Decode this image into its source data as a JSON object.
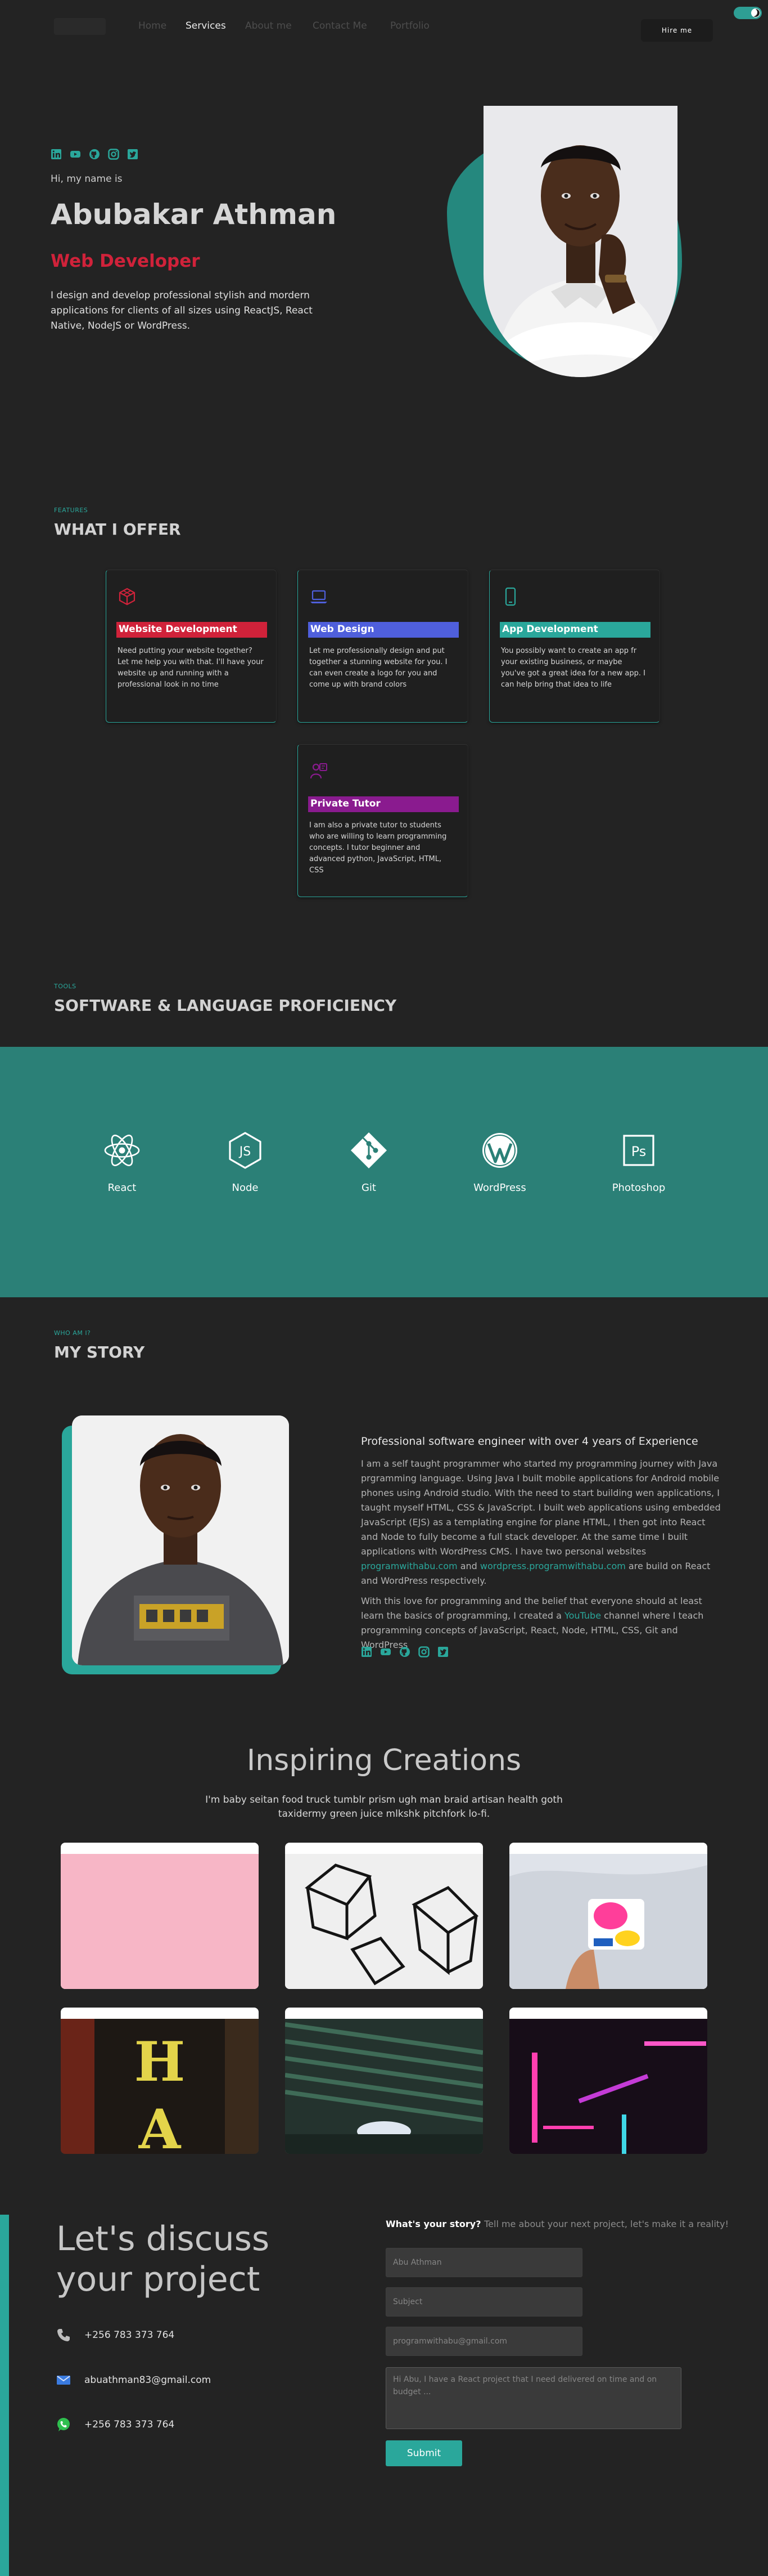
{
  "nav": {
    "links": [
      "Home",
      "Services",
      "About me",
      "Contact Me",
      "Portfolio"
    ],
    "hire_label": "Hire me"
  },
  "hero": {
    "greeting": "Hi, my name is",
    "name": "Abubakar Athman",
    "role": "Web Developer",
    "description": "I design and develop professional stylish and mordern applications for clients of all sizes using ReactJS, React Native, NodeJS or WordPress.",
    "socials": [
      "linkedin-icon",
      "youtube-icon",
      "github-icon",
      "instagram-icon",
      "twitter-icon"
    ]
  },
  "services": {
    "tag": "FEATURES",
    "title": "WHAT I OFFER",
    "cards": [
      {
        "title": "Website Development",
        "text": "Need putting your website together? Let me help you with that. I'll have your website up and running with a professional look in no time",
        "color": "#d0223a",
        "icon": "cube-icon"
      },
      {
        "title": "Web Design",
        "text": "Let me professionally design and put together a stunning website for you. I can even create a logo for you and come up with brand colors",
        "color": "#4f5fdc",
        "icon": "laptop-icon"
      },
      {
        "title": "App Development",
        "text": "You possibly want to create an app fr your existing business, or maybe you've got a great idea for a new app. I can help bring that idea to life",
        "color": "#2aa79b",
        "icon": "phone-icon"
      },
      {
        "title": "Private Tutor",
        "text": "I am also a private tutor to students who are willing to learn programming concepts. I tutor beginner and advanced python, JavaScript, HTML, CSS",
        "color": "#8a1b8f",
        "icon": "tutor-icon"
      }
    ]
  },
  "skills": {
    "tag": "TOOLS",
    "title": "SOFTWARE & LANGUAGE PROFICIENCY",
    "items": [
      "React",
      "Node",
      "Git",
      "WordPress",
      "Photoshop"
    ]
  },
  "story": {
    "tag": "WHO AM I?",
    "title": "MY STORY",
    "heading": "Professional software engineer with over 4 years of Experience",
    "p1": "I am a self taught programmer who started my programming journey with Java prgramming language. Using Java I built mobile applications for Android mobile phones using Android studio. With the need to start building wen applications, I taught myself HTML, CSS & JavaScript. I built web applications using embedded JavaScript (EJS) as a templating engine for plane HTML, I then got into React and Node to fully become a full stack developer. At the same time I built applications with WordPress CMS. I have two personal websites",
    "link1": "programwithabu.com",
    "and": "and",
    "link2": "wordpress.programwithabu.com",
    "p1_end": "are build on React and WordPress respectively.",
    "p2_start": "With this love for programming and the belief that everyone should at least learn the basics of programming, I created a",
    "youtube": "YouTube",
    "p2_end": "channel where I teach programming concepts of JavaScript, React, Node, HTML, CSS, Git and WordPress"
  },
  "portfolio": {
    "title": "Inspiring Creations",
    "subtitle": "I'm baby seitan food truck tumblr prism ugh man braid artisan health goth taxidermy green juice mlkshk pitchfork lo-fi."
  },
  "contact": {
    "heading_line1": "Let's discuss",
    "heading_line2": "your project",
    "phone": "+256 783 373 764",
    "email": "abuathman83@gmail.com",
    "whatsapp": "+256 783 373 764",
    "form_intro_bold": "What's your story?",
    "form_intro_rest": "Tell me about your next project, let's make it a reality!",
    "name_placeholder": "Abu Athman",
    "subject_placeholder": "Subject",
    "email_placeholder": "programwithabu@gmail.com",
    "message_placeholder": "Hi Abu, I have a React project that I need delivered on time and on budget ...",
    "submit_label": "Submit"
  },
  "colors": {
    "accent": "#2aa79b",
    "brand_red": "#d0223a",
    "background": "#232323"
  }
}
